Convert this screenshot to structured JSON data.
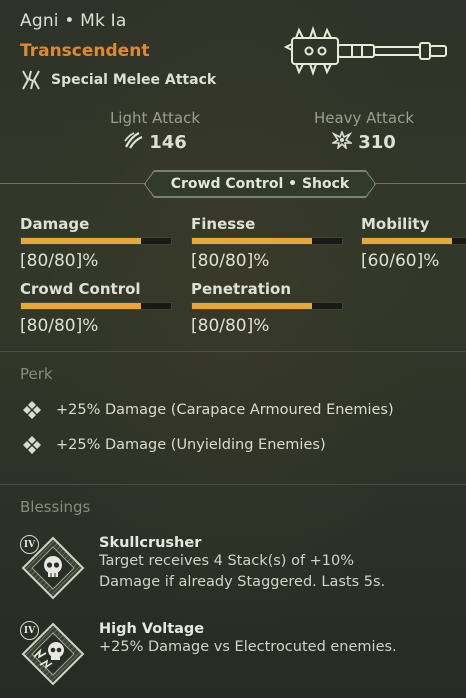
{
  "weapon": {
    "name": "Agni • Mk Ia",
    "rarity": "Transcendent",
    "attack_type": "Special Melee Attack",
    "attack_type_icon": "electric-claw-icon"
  },
  "attacks": {
    "light": {
      "label": "Light Attack",
      "value": "146",
      "icon": "light-attack-icon"
    },
    "heavy": {
      "label": "Heavy Attack",
      "value": "310",
      "icon": "heavy-attack-icon"
    }
  },
  "crowd_control_tag": "Crowd Control • Shock",
  "stats": [
    {
      "name": "Damage",
      "value": "[80/80]%",
      "fill": 0.8
    },
    {
      "name": "Finesse",
      "value": "[80/80]%",
      "fill": 0.8
    },
    {
      "name": "Mobility",
      "value": "[60/60]%",
      "fill": 0.6
    },
    {
      "name": "Crowd Control",
      "value": "[80/80]%",
      "fill": 0.8
    },
    {
      "name": "Penetration",
      "value": "[80/80]%",
      "fill": 0.8
    }
  ],
  "perks": {
    "title": "Perk",
    "items": [
      {
        "text": "+25% Damage (Carapace Armoured Enemies)"
      },
      {
        "text": "+25% Damage (Unyielding Enemies)"
      }
    ]
  },
  "blessings": {
    "title": "Blessings",
    "items": [
      {
        "tier": "IV",
        "name": "Skullcrusher",
        "desc_line1": "Target receives 4 Stack(s) of +10%",
        "desc_line2": "Damage if already Staggered. Lasts 5s.",
        "icon": "skull-icon"
      },
      {
        "tier": "IV",
        "name": "High Voltage",
        "desc_line1": "+25% Damage vs Electrocuted enemies.",
        "icon": "electrified-skull-icon"
      }
    ]
  },
  "colors": {
    "rarity": "#e08a2f",
    "bar_fill": "#e8a73a",
    "background": "#2c3128"
  }
}
